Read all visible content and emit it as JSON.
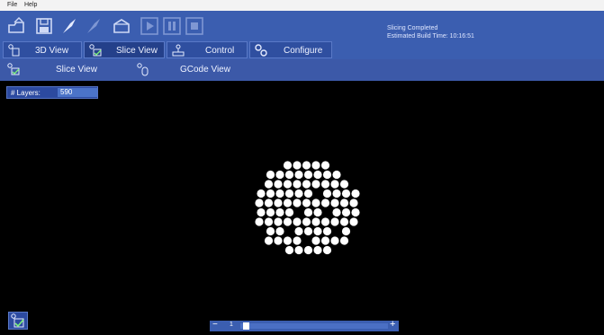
{
  "menubar": {
    "file": "File",
    "help": "Help"
  },
  "toolbar": {
    "icons": [
      "open-icon",
      "save-icon",
      "slice-icon",
      "slice-disabled-icon",
      "material-icon",
      "play-icon",
      "pause-icon",
      "stop-icon"
    ]
  },
  "status": {
    "line1": "Slicing Completed",
    "line2": "Estimated Build Time: 10:16:51"
  },
  "tabs": [
    {
      "label": "3D View"
    },
    {
      "label": "Slice View"
    },
    {
      "label": "Control"
    },
    {
      "label": "Configure"
    }
  ],
  "subnav": {
    "slice_view": "Slice View",
    "gcode_view": "GCode View"
  },
  "layers": {
    "label": "# Layers:",
    "value": "590"
  },
  "slider": {
    "minus": "−",
    "value": "1",
    "plus": "+"
  },
  "colors": {
    "toolbar": "#3b5eb0",
    "tab": "#2f4fa0",
    "viewport": "#000000",
    "dots": "#ffffff"
  }
}
